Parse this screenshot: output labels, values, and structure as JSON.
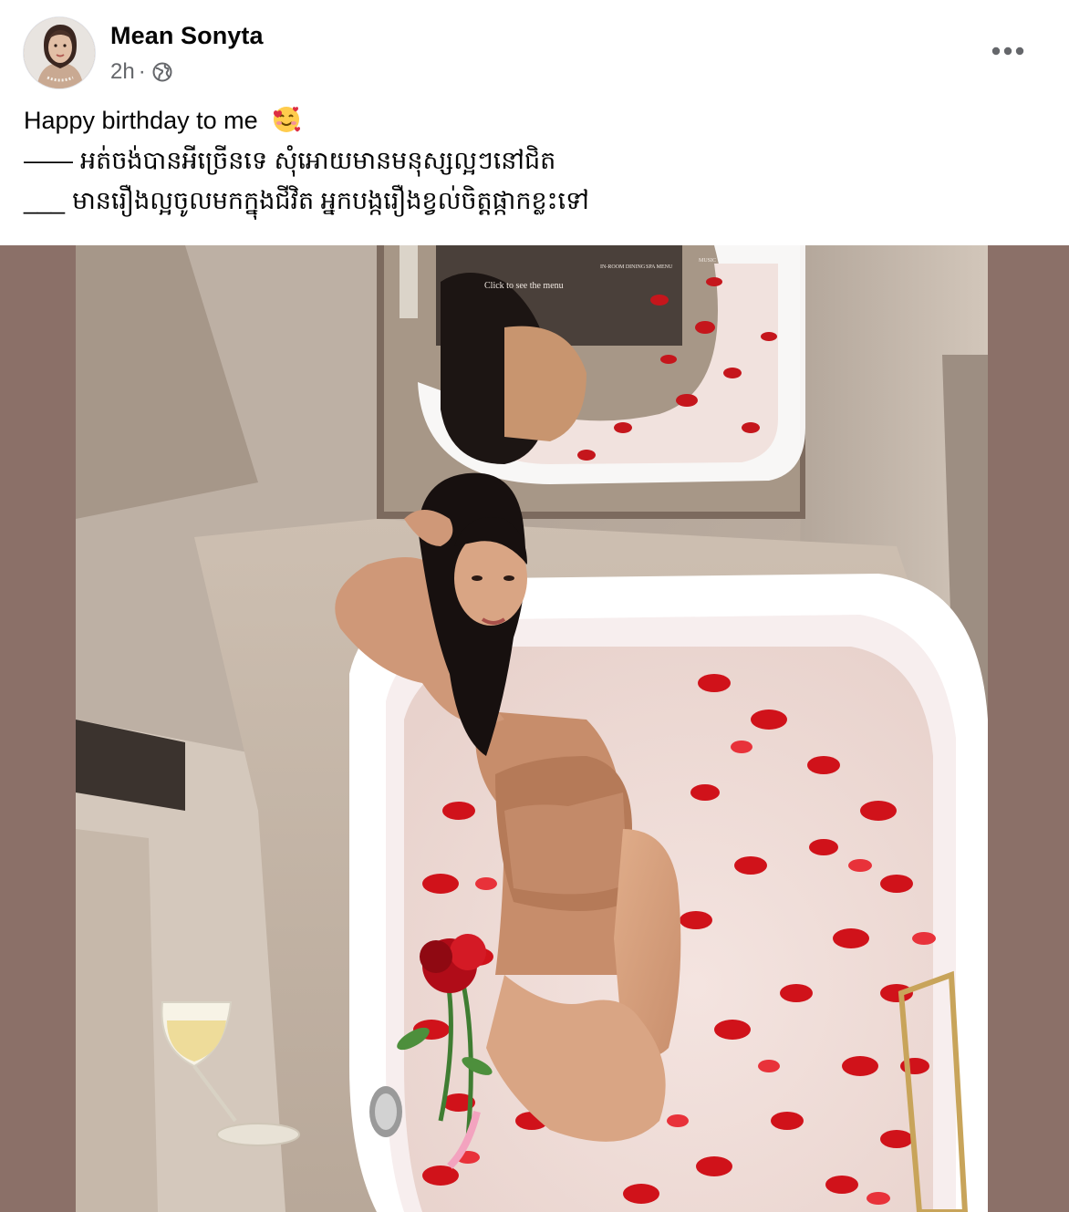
{
  "post": {
    "author": "Mean Sonyta",
    "timestamp": "2h",
    "separator": "·",
    "audience_icon": "globe-icon",
    "more_icon": "more-horizontal-icon"
  },
  "caption": {
    "line1_text": "Happy birthday to me",
    "line1_emoji": "smiling-face-with-hearts-icon",
    "line2_prefix": "——",
    "line2_text": "អត់ចង់បានអីច្រើនទេ សុំអោយមានមនុស្សល្អៗនៅជិត",
    "line3_prefix": "___",
    "line3_text": "មានរឿងល្អចូលមកក្នុងជីវិត អ្នកបង្ករឿងខ្វល់ចិត្តផ្កាកខ្លះទៅ"
  },
  "photo": {
    "mirror_screen_text": "Click to see the menu",
    "mirror_menu_items": [
      "IN-ROOM DINING",
      "SPA MENU",
      "MUSIC"
    ],
    "background_color": "#8b7068"
  }
}
